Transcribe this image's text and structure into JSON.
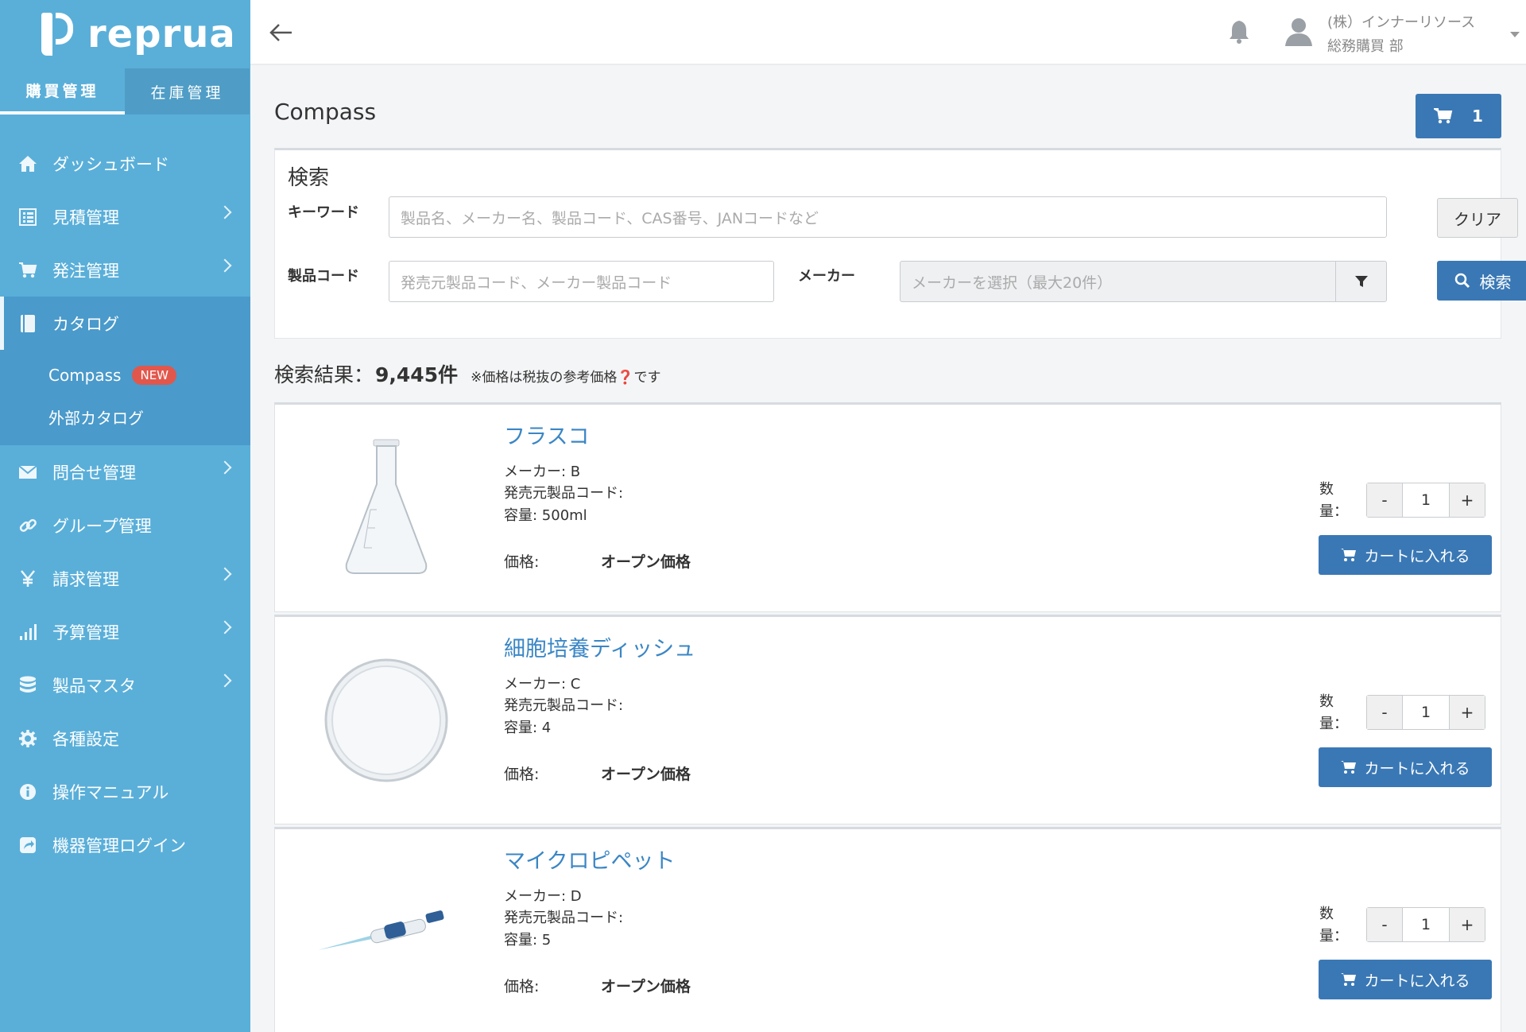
{
  "app": {
    "logo_text": "reprua"
  },
  "topTabs": [
    {
      "label": "購買管理",
      "active": true
    },
    {
      "label": "在庫管理",
      "active": false
    }
  ],
  "nav": {
    "items": [
      {
        "label": "ダッシュボード",
        "icon": "home-icon",
        "chevron": false
      },
      {
        "label": "見積管理",
        "icon": "list-icon",
        "chevron": true
      },
      {
        "label": "発注管理",
        "icon": "cart-icon",
        "chevron": true
      },
      {
        "label": "カタログ",
        "icon": "book-icon",
        "chevron": false,
        "active": true
      },
      {
        "label": "問合せ管理",
        "icon": "envelope-icon",
        "chevron": true
      },
      {
        "label": "グループ管理",
        "icon": "link-icon",
        "chevron": false
      },
      {
        "label": "請求管理",
        "icon": "yen-icon",
        "chevron": true
      },
      {
        "label": "予算管理",
        "icon": "bar-chart-icon",
        "chevron": true
      },
      {
        "label": "製品マスタ",
        "icon": "database-icon",
        "chevron": true
      },
      {
        "label": "各種設定",
        "icon": "gear-icon",
        "chevron": false
      },
      {
        "label": "操作マニュアル",
        "icon": "info-icon",
        "chevron": false
      },
      {
        "label": "機器管理ログイン",
        "icon": "external-link-icon",
        "chevron": false
      }
    ],
    "subItems": [
      {
        "label": "Compass",
        "badge": "NEW"
      },
      {
        "label": "外部カタログ"
      }
    ]
  },
  "header": {
    "company": "(株）インナーリソース",
    "department": "総務購買 部"
  },
  "page": {
    "title": "Compass",
    "cart_count": "1"
  },
  "search": {
    "title": "検索",
    "keyword_label": "キーワード",
    "keyword_placeholder": "製品名、メーカー名、製品コード、CAS番号、JANコードなど",
    "code_label": "製品コード",
    "code_placeholder": "発売元製品コード、メーカー製品コード",
    "maker_label": "メーカー",
    "maker_placeholder": "メーカーを選択（最大20件）",
    "clear_label": "クリア",
    "search_label": "検索"
  },
  "results": {
    "label": "検索結果：",
    "count": "9,445件",
    "note": "※価格は税抜の参考価格❓です"
  },
  "products": [
    {
      "name": "フラスコ",
      "maker": "メーカー: B",
      "code": "発売元製品コード:",
      "capacity": "容量: 500ml",
      "price_label": "価格:",
      "price": "オープン価格",
      "qty_label": "数量：",
      "qty": "1",
      "add_label": "カートに入れる",
      "image": "flask"
    },
    {
      "name": "細胞培養ディッシュ",
      "maker": "メーカー: C",
      "code": "発売元製品コード:",
      "capacity": "容量: 4",
      "price_label": "価格:",
      "price": "オープン価格",
      "qty_label": "数量：",
      "qty": "1",
      "add_label": "カートに入れる",
      "image": "dish"
    },
    {
      "name": "マイクロピペット",
      "maker": "メーカー: D",
      "code": "発売元製品コード:",
      "capacity": "容量: 5",
      "price_label": "価格:",
      "price": "オープン価格",
      "qty_label": "数量：",
      "qty": "1",
      "add_label": "カートに入れる",
      "image": "pipette"
    }
  ],
  "colors": {
    "sidebar": "#5aafd9",
    "primary_button": "#3a78b5",
    "link": "#3a86c5",
    "badge": "#e2574c"
  }
}
